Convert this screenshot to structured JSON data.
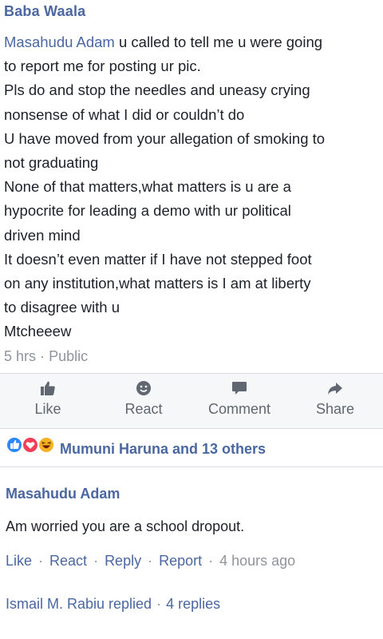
{
  "post": {
    "author": "Baba Waala",
    "mention": "Masahudu Adam",
    "lines": [
      "u called to tell me u were going",
      "to report me for posting ur pic.",
      "Pls do and stop the needles and uneasy crying",
      "nonsense of what I did or couldn’t do",
      "U have moved from your allegation of smoking to",
      "not graduating",
      "None of that matters,what  matters is u are a",
      "hypocrite for leading a demo with ur political",
      "driven mind",
      "It doesn’t even matter if I have not stepped foot",
      "on any institution,what  matters is I am at liberty",
      "to disagree with u",
      "Mtcheeew"
    ],
    "time": "5 hrs",
    "separator": "·",
    "privacy": "Public"
  },
  "actions": {
    "like": "Like",
    "react": "React",
    "comment": "Comment",
    "share": "Share"
  },
  "reactions": {
    "names": "Mumuni Haruna and 13 others",
    "icons": [
      "like-icon",
      "love-icon",
      "haha-icon"
    ]
  },
  "comment": {
    "author": "Masahudu Adam",
    "text": "Am worried you are a school dropout.",
    "like": "Like",
    "react": "React",
    "reply": "Reply",
    "report": "Report",
    "time": "4 hours ago",
    "dot": "·"
  },
  "replies": {
    "replier": "Ismail M. Rabiu replied",
    "dot": "·",
    "count": "4 replies"
  },
  "colors": {
    "link": "#4b67a1",
    "muted": "#90949c",
    "action_bar": "#f6f7f9"
  }
}
